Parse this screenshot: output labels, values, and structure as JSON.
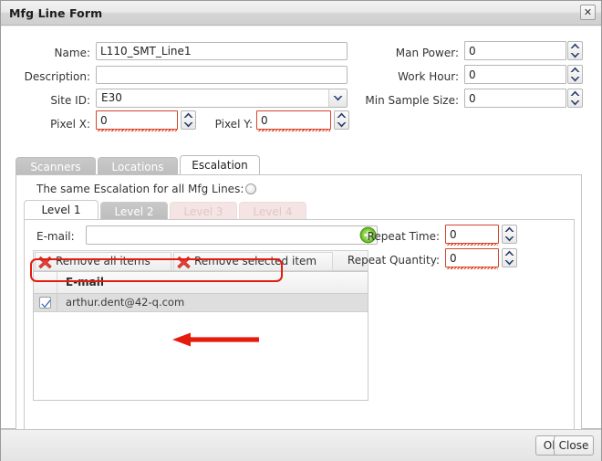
{
  "window": {
    "title": "Mfg Line Form",
    "close_icon": "close-icon"
  },
  "form": {
    "left_fields": [
      {
        "label": "Name:",
        "value": "L110_SMT_Line1",
        "placeholder": ""
      },
      {
        "label": "Description:",
        "value": "",
        "placeholder": ""
      }
    ],
    "site_id": {
      "label": "Site ID:",
      "value": "E30"
    },
    "pixel_x": {
      "label": "Pixel X:",
      "value": "0",
      "error": true
    },
    "pixel_y": {
      "label": "Pixel Y:",
      "value": "0",
      "error": true
    },
    "right_fields": [
      {
        "label": "Man Power:",
        "value": "0"
      },
      {
        "label": "Work Hour:",
        "value": "0"
      },
      {
        "label": "Min Sample Size:",
        "value": "0"
      }
    ]
  },
  "tabs": {
    "items": [
      {
        "label": "Scanners",
        "active": false
      },
      {
        "label": "Locations",
        "active": false
      },
      {
        "label": "Escalation",
        "active": true
      }
    ]
  },
  "escalation": {
    "same_escalation_label": "The same Escalation for all Mfg Lines:",
    "same_escalation_selected": false,
    "level_tabs": [
      {
        "label": "Level 1",
        "state": "active"
      },
      {
        "label": "Level 2",
        "state": "selected"
      },
      {
        "label": "Level 3",
        "state": "disabled"
      },
      {
        "label": "Level 4",
        "state": "disabled"
      }
    ],
    "email_label": "E-mail:",
    "email_value": "",
    "email_placeholder": "",
    "add_icon": "add-circle-icon",
    "toolbar": {
      "remove_all_label": "Remove all items",
      "remove_selected_label": "Remove selected item"
    },
    "grid": {
      "column_email": "E-mail",
      "rows": [
        {
          "checked": true,
          "email": "arthur.dent@42-q.com"
        }
      ]
    },
    "repeat_time": {
      "label": "Repeat Time:",
      "value": "0",
      "error": true
    },
    "repeat_quantity": {
      "label": "Repeat Quantity:",
      "value": "0",
      "error": true
    }
  },
  "footer": {
    "ok_label": "Ok",
    "close_label": "Close"
  },
  "colors": {
    "annotation_red": "#e51b0e",
    "error_border": "#d4462a",
    "tab_inactive": "#c3c3c3",
    "add_green": "#74c832"
  }
}
